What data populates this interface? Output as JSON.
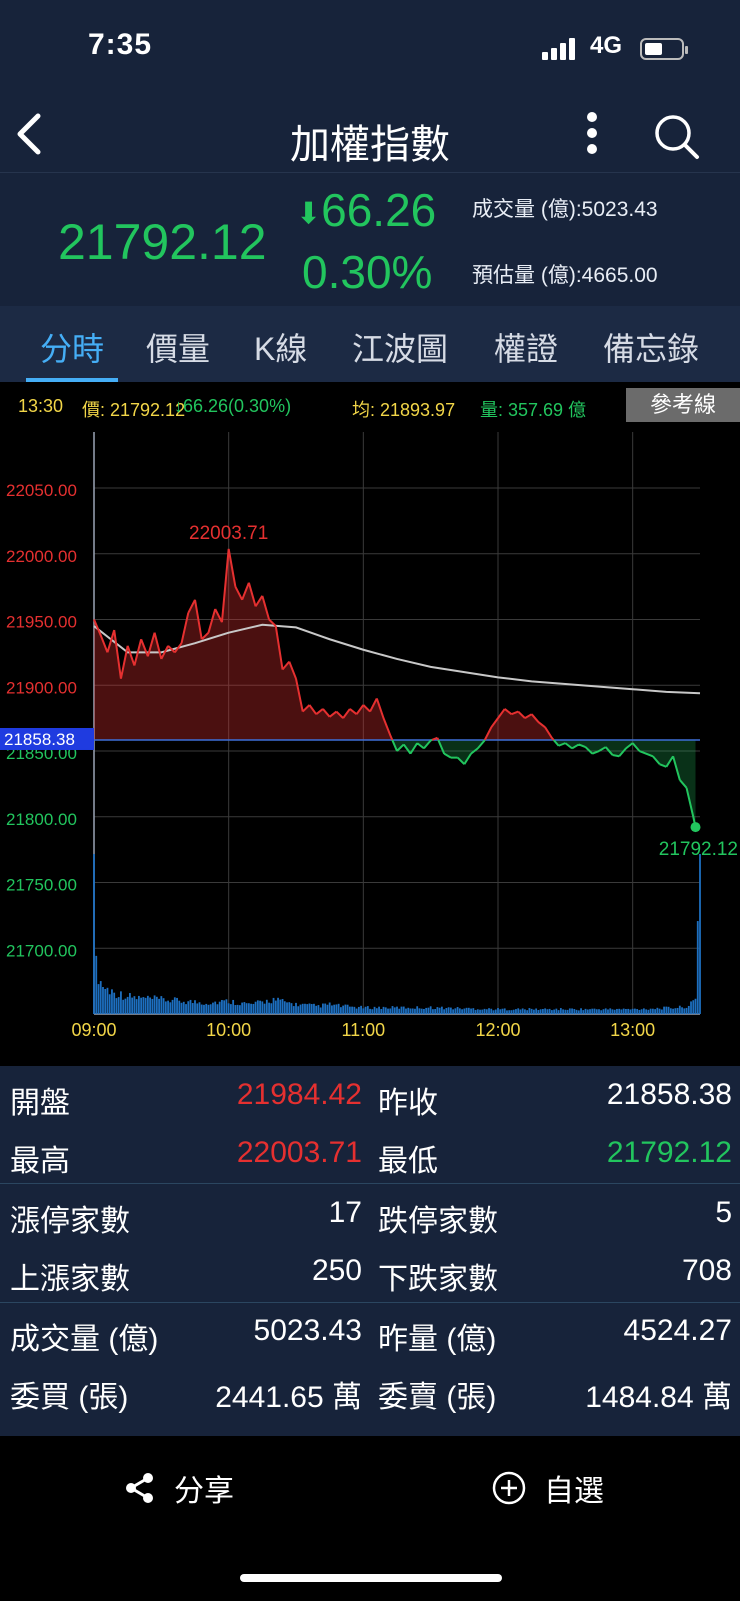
{
  "status": {
    "time": "7:35",
    "network": "4G"
  },
  "header": {
    "title": "加權指數"
  },
  "quote": {
    "price": "21792.12",
    "change": "66.26",
    "change_pct": "0.30%",
    "volume": "成交量 (億):5023.43",
    "est_volume": "預估量 (億):4665.00"
  },
  "tabs": [
    "分時",
    "價量",
    "K線",
    "江波圖",
    "權證",
    "備忘錄"
  ],
  "info": {
    "time": "13:30",
    "price": "價: 21792.12",
    "change": "↓66.26(0.30%)",
    "avg": "均: 21893.97",
    "vol": "量: 357.69 億",
    "ref_button": "參考線"
  },
  "colors": {
    "up": "#e53030",
    "down": "#22c55e",
    "avg": "#c8c8c8",
    "volume": "#1d6fc0"
  },
  "chart_data": {
    "type": "line",
    "reference": 21858.38,
    "reference_label": "21858.38",
    "high_label": "22003.71",
    "last_label": "21792.12",
    "ylim": [
      21650,
      22085
    ],
    "yticks": [
      "22050.00",
      "22000.00",
      "21950.00",
      "21900.00",
      "21850.00",
      "21800.00",
      "21750.00",
      "21700.00"
    ],
    "ytick_values": [
      22050,
      22000,
      21950,
      21900,
      21850,
      21800,
      21750,
      21700
    ],
    "xticks": [
      "09:00",
      "10:00",
      "11:00",
      "12:00",
      "13:00"
    ],
    "x_minutes": [
      0,
      3,
      6,
      9,
      12,
      15,
      18,
      21,
      24,
      27,
      30,
      33,
      36,
      39,
      42,
      45,
      48,
      51,
      54,
      57,
      60,
      63,
      66,
      69,
      72,
      75,
      78,
      81,
      84,
      87,
      90,
      93,
      96,
      99,
      102,
      105,
      108,
      111,
      114,
      117,
      120,
      123,
      126,
      129,
      132,
      135,
      138,
      141,
      144,
      147,
      150,
      153,
      156,
      159,
      162,
      165,
      168,
      171,
      174,
      177,
      180,
      183,
      186,
      189,
      192,
      195,
      198,
      201,
      204,
      207,
      210,
      213,
      216,
      219,
      222,
      225,
      228,
      231,
      234,
      237,
      240,
      243,
      246,
      249,
      252,
      255,
      258,
      261,
      264,
      267,
      268,
      270
    ],
    "price": [
      21950,
      21938,
      21925,
      21942,
      21905,
      21930,
      21915,
      21935,
      21922,
      21940,
      21920,
      21930,
      21925,
      21932,
      21955,
      21965,
      21935,
      21940,
      21958,
      21948,
      22003.71,
      21975,
      21965,
      21978,
      21960,
      21968,
      21950,
      21945,
      21912,
      21918,
      21905,
      21880,
      21885,
      21878,
      21882,
      21876,
      21880,
      21875,
      21882,
      21878,
      21885,
      21880,
      21890,
      21875,
      21862,
      21850,
      21855,
      21848,
      21856,
      21852,
      21858,
      21860,
      21848,
      21845,
      21845,
      21840,
      21848,
      21852,
      21858,
      21868,
      21875,
      21882,
      21878,
      21880,
      21875,
      21878,
      21872,
      21868,
      21860,
      21854,
      21856,
      21852,
      21855,
      21853,
      21848,
      21850,
      21853,
      21847,
      21846,
      21852,
      21856,
      21850,
      21848,
      21846,
      21840,
      21838,
      21846,
      21828,
      21822,
      21800,
      21792.12
    ],
    "avg_minutes": [
      0,
      15,
      30,
      45,
      60,
      75,
      90,
      105,
      120,
      135,
      150,
      165,
      180,
      195,
      210,
      225,
      240,
      255,
      270
    ],
    "avg": [
      21945,
      21925,
      21925,
      21932,
      21940,
      21946,
      21944,
      21935,
      21927,
      21920,
      21914,
      21910,
      21906,
      21903,
      21901,
      21899,
      21897,
      21895,
      21893.97
    ],
    "volume_minutes": [
      0,
      1,
      2,
      3,
      5,
      10,
      15,
      20,
      30,
      40,
      50,
      60,
      70,
      80,
      90,
      100,
      105,
      110,
      120,
      130,
      150,
      180,
      200,
      220,
      240,
      260,
      265,
      268,
      270
    ],
    "volume": [
      100,
      30,
      24,
      20,
      16,
      13,
      11,
      10,
      9,
      8,
      7,
      8,
      6,
      9,
      6,
      5,
      6,
      5,
      4,
      4,
      4,
      3,
      3,
      3,
      3,
      4,
      5,
      9,
      100
    ]
  },
  "stats": {
    "rows": [
      {
        "l1": "開盤",
        "v1": "21984.42",
        "c1": "up",
        "l2": "昨收",
        "v2": "21858.38",
        "c2": "neutral"
      },
      {
        "l1": "最高",
        "v1": "22003.71",
        "c1": "up",
        "l2": "最低",
        "v2": "21792.12",
        "c2": "down"
      },
      {
        "l1": "漲停家數",
        "v1": "17",
        "c1": "neutral",
        "l2": "跌停家數",
        "v2": "5",
        "c2": "neutral"
      },
      {
        "l1": "上漲家數",
        "v1": "250",
        "c1": "neutral",
        "l2": "下跌家數",
        "v2": "708",
        "c2": "neutral"
      },
      {
        "l1": "成交量 (億)",
        "v1": "5023.43",
        "c1": "neutral",
        "l2": "昨量 (億)",
        "v2": "4524.27",
        "c2": "neutral"
      },
      {
        "l1": "委買 (張)",
        "v1": "2441.65 萬",
        "c1": "neutral",
        "l2": "委賣 (張)",
        "v2": "1484.84 萬",
        "c2": "neutral"
      }
    ]
  },
  "bottom": {
    "share": "分享",
    "watchlist": "自選"
  }
}
